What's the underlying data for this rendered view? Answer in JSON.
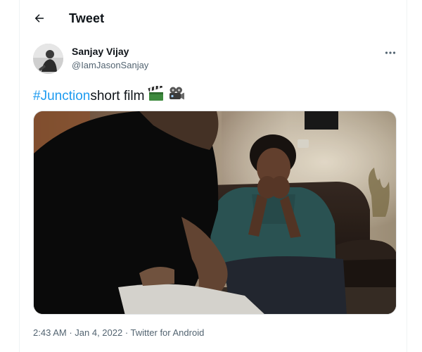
{
  "header": {
    "title": "Tweet",
    "back_icon": "arrow-left-icon"
  },
  "tweet": {
    "author": {
      "name": "Sanjay Vijay",
      "handle": "@IamJasonSanjay"
    },
    "text": {
      "hashtag": "#Junction",
      "body": " short film",
      "emojis": [
        "clapper-board-icon",
        "film-projector-icon"
      ]
    },
    "media": {
      "type": "video-frame",
      "subject": "two men in a dim room"
    },
    "meta": {
      "time": "2:43 AM",
      "separator": " · ",
      "date": "Jan 4, 2022",
      "source": "Twitter for Android"
    },
    "colors": {
      "link": "#1d9bf0",
      "secondary_text": "#536471",
      "primary_text": "#0f1419"
    }
  }
}
